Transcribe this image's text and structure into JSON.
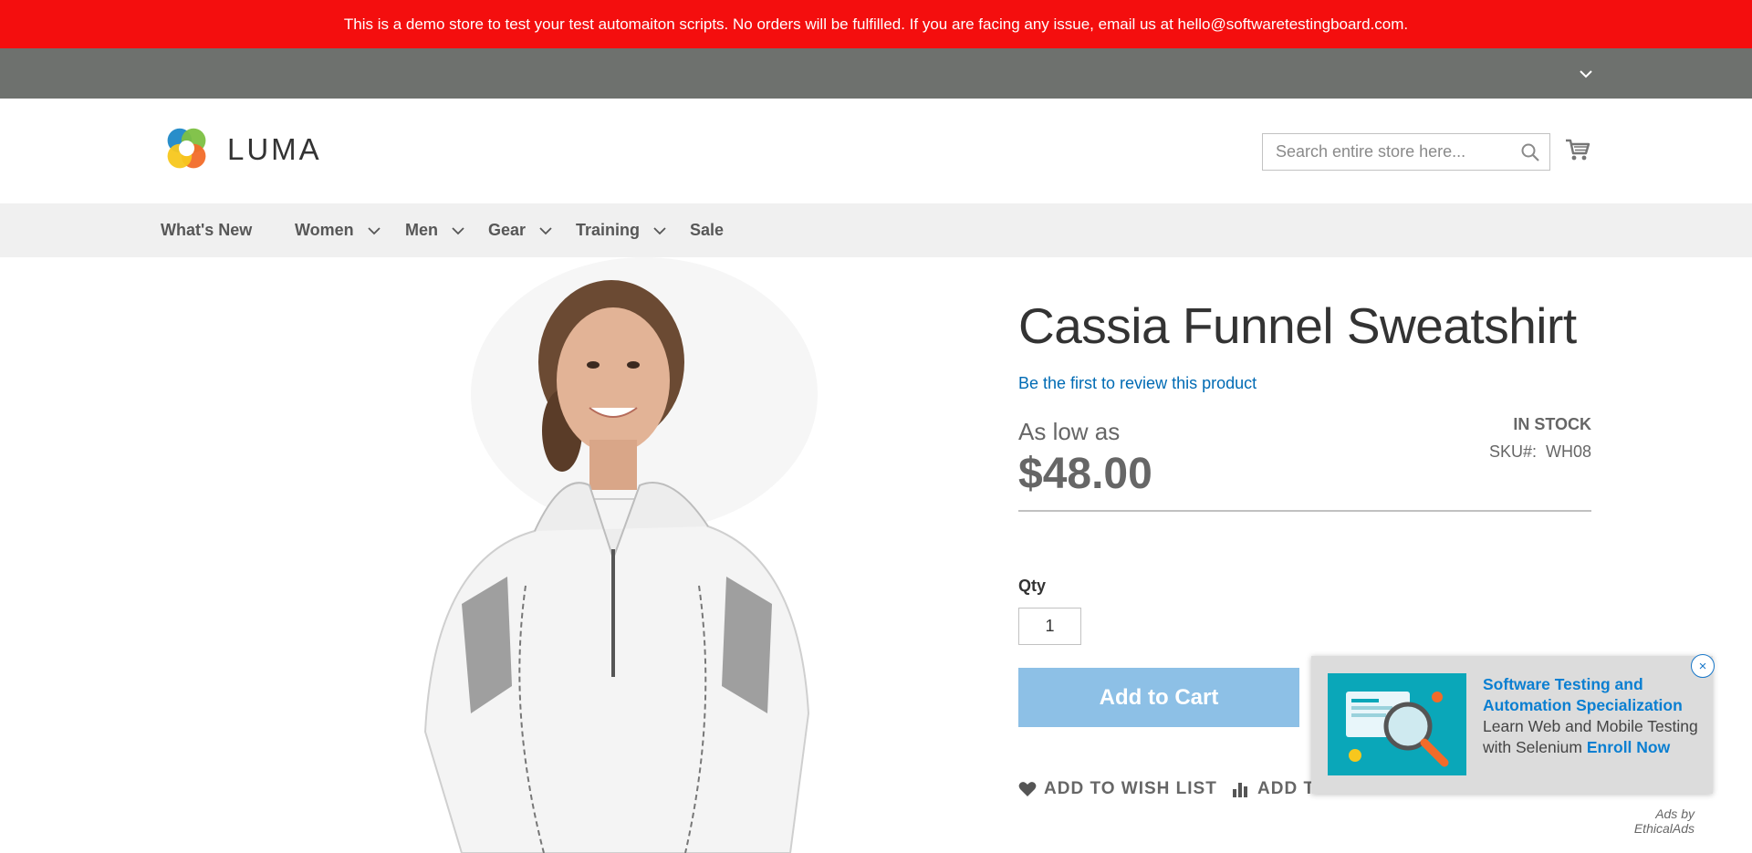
{
  "demo_notice": "This is a demo store to test your test automaiton scripts. No orders will be fulfilled. If you are facing any issue, email us at hello@softwaretestingboard.com.",
  "header": {
    "logo_text": "LUMA",
    "search_placeholder": "Search entire store here...",
    "icons": [
      "chevron-down-icon",
      "search-icon",
      "cart-icon"
    ]
  },
  "nav": {
    "items": [
      {
        "label": "What's New",
        "has_submenu": false
      },
      {
        "label": "Women",
        "has_submenu": true
      },
      {
        "label": "Men",
        "has_submenu": true
      },
      {
        "label": "Gear",
        "has_submenu": true
      },
      {
        "label": "Training",
        "has_submenu": true
      },
      {
        "label": "Sale",
        "has_submenu": false
      }
    ]
  },
  "product": {
    "title": "Cassia Funnel Sweatshirt",
    "review_link": "Be the first to review this product",
    "as_low_as": "As low as",
    "price": "$48.00",
    "stock": "IN STOCK",
    "sku_label": "SKU#:",
    "sku_value": "WH08",
    "qty_label": "Qty",
    "qty_value": "1",
    "add_to_cart": "Add to Cart",
    "wish_list": "ADD TO WISH LIST",
    "compare": "ADD TO COMPARE"
  },
  "ad": {
    "title": "Software Testing and Automation Specialization",
    "body": "Learn Web and Mobile Testing with Selenium",
    "cta": "Enroll Now",
    "close": "×",
    "credit": "Ads by EthicalAds"
  },
  "colors": {
    "demo_bar": "#f40e0e",
    "panel": "#6e716e",
    "nav_bg": "#f0f0f0",
    "link": "#006bb4",
    "add_to_cart": "#8dc0e6"
  }
}
